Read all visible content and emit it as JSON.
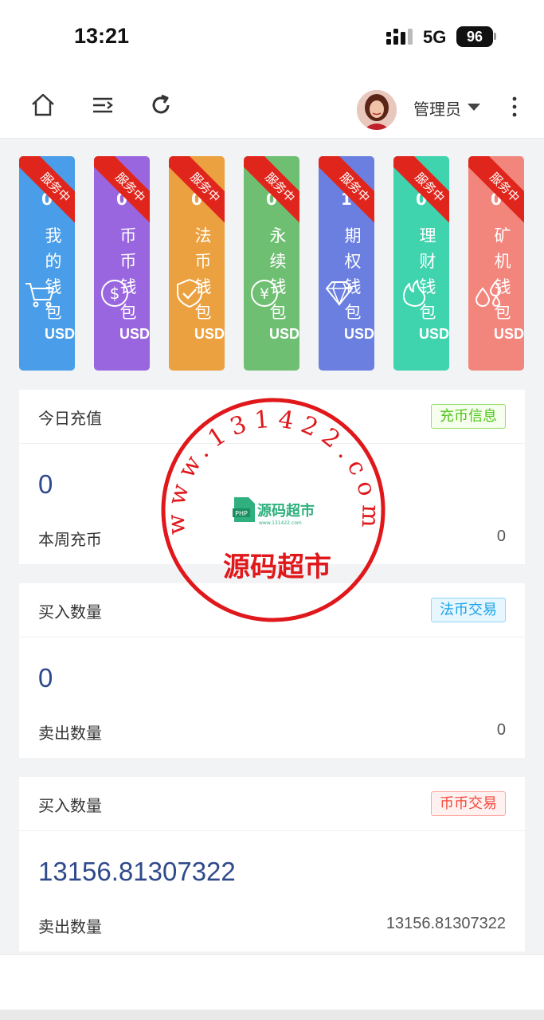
{
  "status_bar": {
    "time": "13:21",
    "network": "5G",
    "battery": "96"
  },
  "header": {
    "home_icon": "home-icon",
    "menu_icon": "menu-collapse-icon",
    "refresh_icon": "refresh-icon",
    "user_name": "管理员",
    "more_icon": "more-vertical-icon"
  },
  "wallets": [
    {
      "name": "我的钱包",
      "badge": "服务中",
      "unit": "USD",
      "value": "0",
      "icon": "cart-icon",
      "color": "#4a9de8"
    },
    {
      "name": "币币钱包",
      "badge": "服务中",
      "unit": "USD",
      "value": "0",
      "icon": "dollar-coin-icon",
      "color": "#9a66df"
    },
    {
      "name": "法币钱包",
      "badge": "服务中",
      "unit": "USD",
      "value": "0",
      "icon": "shield-check-icon",
      "color": "#eba13f"
    },
    {
      "name": "永续钱包",
      "badge": "服务中",
      "unit": "USD",
      "value": "0",
      "icon": "yen-coin-icon",
      "color": "#6fbf73"
    },
    {
      "name": "期权钱包",
      "badge": "服务中",
      "unit": "USD",
      "value": "1",
      "icon": "diamond-icon",
      "color": "#6a7fe0"
    },
    {
      "name": "理财钱包",
      "badge": "服务中",
      "unit": "USD",
      "value": "0",
      "icon": "flame-icon",
      "color": "#3fd3ae"
    },
    {
      "name": "矿机钱包",
      "badge": "服务中",
      "unit": "USD",
      "value": "0",
      "icon": "drops-icon",
      "color": "#f2867d"
    }
  ],
  "panels": [
    {
      "title": "今日充值",
      "tag": "充币信息",
      "tag_color": "#52c41a",
      "value": "0",
      "sub_label": "本周充币",
      "sub_value": "0"
    },
    {
      "title": "买入数量",
      "tag": "法币交易",
      "tag_color": "#1aa3e8",
      "value": "0",
      "sub_label": "卖出数量",
      "sub_value": "0"
    },
    {
      "title": "买入数量",
      "tag": "币币交易",
      "tag_color": "#f5483b",
      "value": "13156.81307322",
      "sub_label": "卖出数量",
      "sub_value": "13156.81307322"
    }
  ],
  "watermark": {
    "site": "www.131422.com",
    "name": "源码超市",
    "logo_text": "源码超市",
    "logo_sub": "www.131422.com",
    "color": "#e0181b"
  }
}
